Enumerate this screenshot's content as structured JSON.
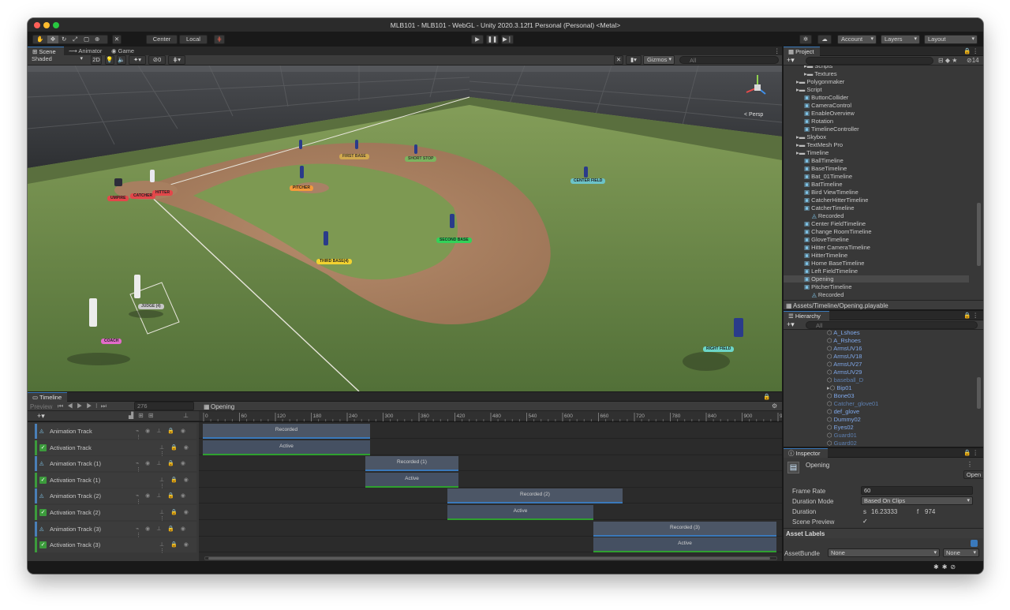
{
  "window": {
    "title": "MLB101 - MLB101 - WebGL - Unity 2020.3.12f1 Personal (Personal) <Metal>"
  },
  "toolbar": {
    "center": "Center",
    "local": "Local",
    "account": "Account",
    "layers": "Layers",
    "layout": "Layout"
  },
  "scene_tabs": {
    "scene": "Scene",
    "animator": "Animator",
    "game": "Game"
  },
  "scene_toolbar": {
    "shading": "Shaded",
    "mode_2d": "2D",
    "hidden_count": "0",
    "gizmos": "Gizmos",
    "search_placeholder": "All",
    "persp": "< Persp"
  },
  "scene_labels": {
    "umpire": "UMPIRE",
    "catcher": "CATCHER",
    "hitter": "HITTER",
    "pitcher": "PITCHER",
    "first_base": "FIRST BASE",
    "short_stop": "SHORT STOP",
    "center_field": "CENTER FIELD",
    "second_base": "SECOND BASE",
    "third_base": "THIRD BASE(4)",
    "judge": "JUDGE (4)",
    "coach": "COACH",
    "right_field": "RIGHT FIELD"
  },
  "timeline": {
    "tab": "Timeline",
    "preview": "Preview",
    "frame": "276",
    "asset": "Opening",
    "ruler": [
      "0",
      "60",
      "120",
      "180",
      "240",
      "300",
      "360",
      "420",
      "480",
      "540",
      "600",
      "660",
      "720",
      "780",
      "840",
      "900",
      "960"
    ],
    "tracks": [
      {
        "name": "Animation Track",
        "kind": "anim"
      },
      {
        "name": "Activation Track",
        "kind": "act"
      },
      {
        "name": "Animation Track (1)",
        "kind": "anim"
      },
      {
        "name": "Activation Track (1)",
        "kind": "act"
      },
      {
        "name": "Animation Track (2)",
        "kind": "anim"
      },
      {
        "name": "Activation Track (2)",
        "kind": "act"
      },
      {
        "name": "Animation Track (3)",
        "kind": "anim"
      },
      {
        "name": "Activation Track (3)",
        "kind": "act"
      }
    ],
    "clips": [
      {
        "label": "Recorded"
      },
      {
        "label": "Active"
      },
      {
        "label": "Recorded (1)"
      },
      {
        "label": "Active"
      },
      {
        "label": "Recorded (2)"
      },
      {
        "label": "Active"
      },
      {
        "label": "Recorded (3)"
      },
      {
        "label": "Active"
      }
    ]
  },
  "project": {
    "tab": "Project",
    "hidden_count": "14",
    "items": [
      "Scripts",
      "Textures",
      "Polygonmaker",
      "Script",
      "ButtonCollider",
      "CameraControl",
      "EnableOverview",
      "Rotation",
      "TimelineController",
      "Skybox",
      "TextMesh Pro",
      "Timeline",
      "BallTimeline",
      "BaseTimeline",
      "Bat_01Timeline",
      "BatTimeline",
      "Bird ViewTimeline",
      "CatcherHitterTimeline",
      "CatcherTimeline",
      "Recorded",
      "Center FieldTimeline",
      "Change RoomTimeline",
      "GloveTimeline",
      "Hitter CameraTimeline",
      "HitterTimeline",
      "Home BaseTimeline",
      "Left FieldTimeline",
      "Opening",
      "PitcherTimeline",
      "Recorded"
    ],
    "path": "Assets/Timeline/Opening.playable"
  },
  "hierarchy": {
    "tab": "Hierarchy",
    "search_placeholder": "All",
    "items": [
      "A_Lshoes",
      "A_Rshoes",
      "ArmsUV16",
      "ArmsUV18",
      "ArmsUV27",
      "ArmsUV29",
      "baseball_D",
      "Bip01",
      "Bone03",
      "Catcher_glove01",
      "def_glove",
      "Dummy02",
      "Eyes02",
      "Guard01",
      "Guard02"
    ]
  },
  "inspector": {
    "tab": "Inspector",
    "asset_name": "Opening",
    "open": "Open",
    "frame_rate_label": "Frame Rate",
    "frame_rate": "60",
    "duration_mode_label": "Duration Mode",
    "duration_mode": "Based On Clips",
    "duration_label": "Duration",
    "seconds_prefix": "s",
    "seconds": "16.23333",
    "frames_prefix": "f",
    "frames": "974",
    "scene_preview_label": "Scene Preview",
    "asset_labels": "Asset Labels",
    "asset_bundle_label": "AssetBundle",
    "bundle": "None",
    "variant": "None"
  },
  "colors": {
    "accent": "#3a79bb",
    "active_green": "#2fa02f",
    "panel": "#383838"
  }
}
